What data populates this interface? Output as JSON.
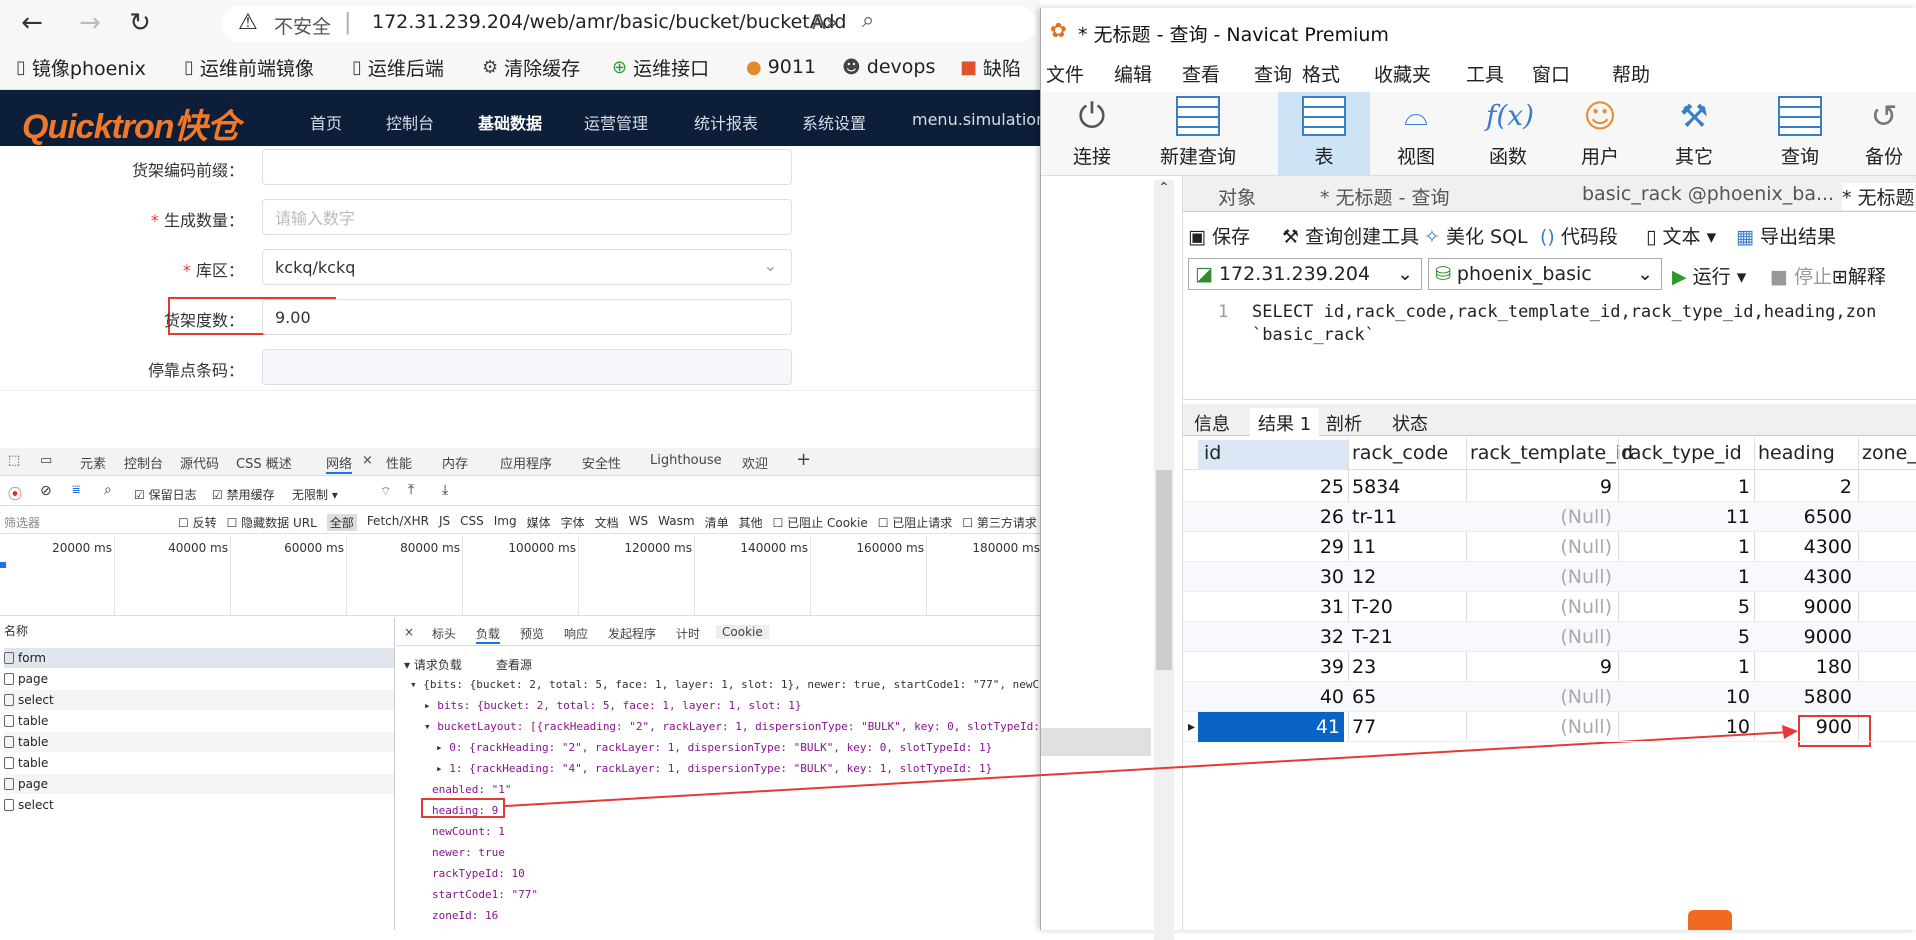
{
  "browser": {
    "security_label": "不安全",
    "url": "172.31.239.204/web/amr/basic/bucket/bucketAdd",
    "bookmarks": [
      "镜像phoenix",
      "运维前端镜像",
      "运维后端",
      "清除缓存",
      "运维接口",
      "9011",
      "devops",
      "缺陷"
    ]
  },
  "app": {
    "logo": "Quicktron快仓",
    "nav": [
      "首页",
      "控制台",
      "基础数据",
      "运营管理",
      "统计报表",
      "系统设置",
      "menu.simulation"
    ]
  },
  "form": {
    "prefix_label": "货架编码前缀：",
    "count_label": "生成数量：",
    "count_placeholder": "请输入数字",
    "zone_label": "库区：",
    "zone_value": "kckq/kckq",
    "heading_label": "货架度数：",
    "heading_value": "9.00",
    "dock_label": "停靠点条码："
  },
  "devtools": {
    "tabs": [
      "元素",
      "控制台",
      "源代码",
      "CSS 概述",
      "网络",
      "性能",
      "内存",
      "应用程序",
      "安全性",
      "Lighthouse",
      "欢迎"
    ],
    "toolbar": {
      "preserve_log": "保留日志",
      "disable_cache": "禁用缓存",
      "throttle": "无限制"
    },
    "filter": {
      "placeholder": "筛选器",
      "items": [
        "反转",
        "隐藏数据 URL",
        "全部",
        "Fetch/XHR",
        "JS",
        "CSS",
        "Img",
        "媒体",
        "字体",
        "文档",
        "WS",
        "Wasm",
        "清单",
        "其他",
        "已阻止 Cookie",
        "已阻止请求",
        "第三方请求"
      ]
    },
    "timeline": [
      "20000 ms",
      "40000 ms",
      "60000 ms",
      "80000 ms",
      "100000 ms",
      "120000 ms",
      "140000 ms",
      "160000 ms",
      "180000 ms"
    ],
    "name_header": "名称",
    "requests": [
      "form",
      "page",
      "select",
      "table",
      "table",
      "table",
      "page",
      "select"
    ],
    "detail_tabs": [
      "标头",
      "负载",
      "预览",
      "响应",
      "发起程序",
      "计时",
      "Cookie"
    ],
    "payload_title": "请求负载",
    "view_source": "查看源",
    "payload_lines": [
      "{bits: {bucket: 2, total: 5, face: 1, layer: 1, slot: 1}, newer: true, startCode1: \"77\", newC",
      "bits: {bucket: 2, total: 5, face: 1, layer: 1, slot: 1}",
      "bucketLayout: [{rackHeading: \"2\", rackLayer: 1, dispersionType: \"BULK\", key: 0, slotTypeId:",
      "0: {rackHeading: \"2\", rackLayer: 1, dispersionType: \"BULK\", key: 0, slotTypeId: 1}",
      "1: {rackHeading: \"4\", rackLayer: 1, dispersionType: \"BULK\", key: 1, slotTypeId: 1}",
      "enabled: \"1\"",
      "heading: 9",
      "newCount: 1",
      "newer: true",
      "rackTypeId: 10",
      "startCode1: \"77\"",
      "zoneId: 16"
    ]
  },
  "navicat": {
    "title": "* 无标题 - 查询 - Navicat Premium",
    "menu": [
      "文件",
      "编辑",
      "查看",
      "查询",
      "格式",
      "收藏夹",
      "工具",
      "窗口",
      "帮助"
    ],
    "toolbar": [
      "连接",
      "新建查询",
      "表",
      "视图",
      "函数",
      "用户",
      "其它",
      "查询",
      "备份"
    ],
    "tabs": [
      "对象",
      "* 无标题 - 查询",
      "basic_rack @phoenix_ba...",
      "* 无标题"
    ],
    "query_toolbar": [
      "保存",
      "查询创建工具",
      "美化 SQL",
      "代码段",
      "文本",
      "导出结果"
    ],
    "connection": "172.31.239.204",
    "database": "phoenix_basic",
    "run": "运行",
    "stop": "停止",
    "explain": "解释",
    "sql_line_no": "1",
    "sql_line1": "SELECT id,rack_code,rack_template_id,rack_type_id,heading,zon",
    "sql_line2": "`basic_rack`",
    "result_tabs": [
      "信息",
      "结果 1",
      "剖析",
      "状态"
    ],
    "columns": [
      "id",
      "rack_code",
      "rack_template_id",
      "rack_type_id",
      "heading",
      "zone_i"
    ],
    "rows": [
      [
        "25",
        "5834",
        "9",
        "1",
        "2"
      ],
      [
        "26",
        "tr-11",
        "(Null)",
        "11",
        "6500"
      ],
      [
        "29",
        "11",
        "(Null)",
        "1",
        "4300"
      ],
      [
        "30",
        "12",
        "(Null)",
        "1",
        "4300"
      ],
      [
        "31",
        "T-20",
        "(Null)",
        "5",
        "9000"
      ],
      [
        "32",
        "T-21",
        "(Null)",
        "5",
        "9000"
      ],
      [
        "39",
        "23",
        "9",
        "1",
        "180"
      ],
      [
        "40",
        "65",
        "(Null)",
        "10",
        "5800"
      ],
      [
        "41",
        "77",
        "(Null)",
        "10",
        "900"
      ]
    ]
  },
  "colors": {
    "accent_red": "#e53935",
    "nav_bg": "#0d1e38",
    "logo": "#f07828",
    "selected": "#0a64c8"
  }
}
